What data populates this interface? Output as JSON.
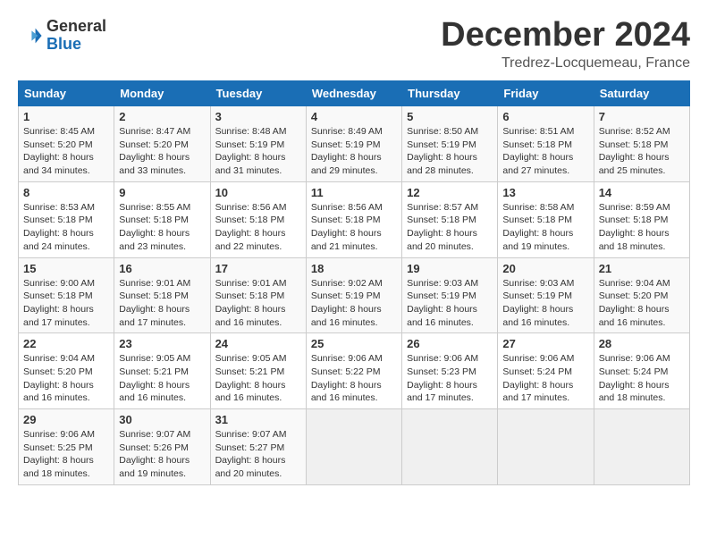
{
  "logo": {
    "general": "General",
    "blue": "Blue"
  },
  "title": "December 2024",
  "location": "Tredrez-Locquemeau, France",
  "days_header": [
    "Sunday",
    "Monday",
    "Tuesday",
    "Wednesday",
    "Thursday",
    "Friday",
    "Saturday"
  ],
  "weeks": [
    [
      {
        "day": "1",
        "sunrise": "8:45 AM",
        "sunset": "5:20 PM",
        "daylight": "8 hours and 34 minutes."
      },
      {
        "day": "2",
        "sunrise": "8:47 AM",
        "sunset": "5:20 PM",
        "daylight": "8 hours and 33 minutes."
      },
      {
        "day": "3",
        "sunrise": "8:48 AM",
        "sunset": "5:19 PM",
        "daylight": "8 hours and 31 minutes."
      },
      {
        "day": "4",
        "sunrise": "8:49 AM",
        "sunset": "5:19 PM",
        "daylight": "8 hours and 29 minutes."
      },
      {
        "day": "5",
        "sunrise": "8:50 AM",
        "sunset": "5:19 PM",
        "daylight": "8 hours and 28 minutes."
      },
      {
        "day": "6",
        "sunrise": "8:51 AM",
        "sunset": "5:18 PM",
        "daylight": "8 hours and 27 minutes."
      },
      {
        "day": "7",
        "sunrise": "8:52 AM",
        "sunset": "5:18 PM",
        "daylight": "8 hours and 25 minutes."
      }
    ],
    [
      {
        "day": "8",
        "sunrise": "8:53 AM",
        "sunset": "5:18 PM",
        "daylight": "8 hours and 24 minutes."
      },
      {
        "day": "9",
        "sunrise": "8:55 AM",
        "sunset": "5:18 PM",
        "daylight": "8 hours and 23 minutes."
      },
      {
        "day": "10",
        "sunrise": "8:56 AM",
        "sunset": "5:18 PM",
        "daylight": "8 hours and 22 minutes."
      },
      {
        "day": "11",
        "sunrise": "8:56 AM",
        "sunset": "5:18 PM",
        "daylight": "8 hours and 21 minutes."
      },
      {
        "day": "12",
        "sunrise": "8:57 AM",
        "sunset": "5:18 PM",
        "daylight": "8 hours and 20 minutes."
      },
      {
        "day": "13",
        "sunrise": "8:58 AM",
        "sunset": "5:18 PM",
        "daylight": "8 hours and 19 minutes."
      },
      {
        "day": "14",
        "sunrise": "8:59 AM",
        "sunset": "5:18 PM",
        "daylight": "8 hours and 18 minutes."
      }
    ],
    [
      {
        "day": "15",
        "sunrise": "9:00 AM",
        "sunset": "5:18 PM",
        "daylight": "8 hours and 17 minutes."
      },
      {
        "day": "16",
        "sunrise": "9:01 AM",
        "sunset": "5:18 PM",
        "daylight": "8 hours and 17 minutes."
      },
      {
        "day": "17",
        "sunrise": "9:01 AM",
        "sunset": "5:18 PM",
        "daylight": "8 hours and 16 minutes."
      },
      {
        "day": "18",
        "sunrise": "9:02 AM",
        "sunset": "5:19 PM",
        "daylight": "8 hours and 16 minutes."
      },
      {
        "day": "19",
        "sunrise": "9:03 AM",
        "sunset": "5:19 PM",
        "daylight": "8 hours and 16 minutes."
      },
      {
        "day": "20",
        "sunrise": "9:03 AM",
        "sunset": "5:19 PM",
        "daylight": "8 hours and 16 minutes."
      },
      {
        "day": "21",
        "sunrise": "9:04 AM",
        "sunset": "5:20 PM",
        "daylight": "8 hours and 16 minutes."
      }
    ],
    [
      {
        "day": "22",
        "sunrise": "9:04 AM",
        "sunset": "5:20 PM",
        "daylight": "8 hours and 16 minutes."
      },
      {
        "day": "23",
        "sunrise": "9:05 AM",
        "sunset": "5:21 PM",
        "daylight": "8 hours and 16 minutes."
      },
      {
        "day": "24",
        "sunrise": "9:05 AM",
        "sunset": "5:21 PM",
        "daylight": "8 hours and 16 minutes."
      },
      {
        "day": "25",
        "sunrise": "9:06 AM",
        "sunset": "5:22 PM",
        "daylight": "8 hours and 16 minutes."
      },
      {
        "day": "26",
        "sunrise": "9:06 AM",
        "sunset": "5:23 PM",
        "daylight": "8 hours and 17 minutes."
      },
      {
        "day": "27",
        "sunrise": "9:06 AM",
        "sunset": "5:24 PM",
        "daylight": "8 hours and 17 minutes."
      },
      {
        "day": "28",
        "sunrise": "9:06 AM",
        "sunset": "5:24 PM",
        "daylight": "8 hours and 18 minutes."
      }
    ],
    [
      {
        "day": "29",
        "sunrise": "9:06 AM",
        "sunset": "5:25 PM",
        "daylight": "8 hours and 18 minutes."
      },
      {
        "day": "30",
        "sunrise": "9:07 AM",
        "sunset": "5:26 PM",
        "daylight": "8 hours and 19 minutes."
      },
      {
        "day": "31",
        "sunrise": "9:07 AM",
        "sunset": "5:27 PM",
        "daylight": "8 hours and 20 minutes."
      },
      null,
      null,
      null,
      null
    ]
  ]
}
